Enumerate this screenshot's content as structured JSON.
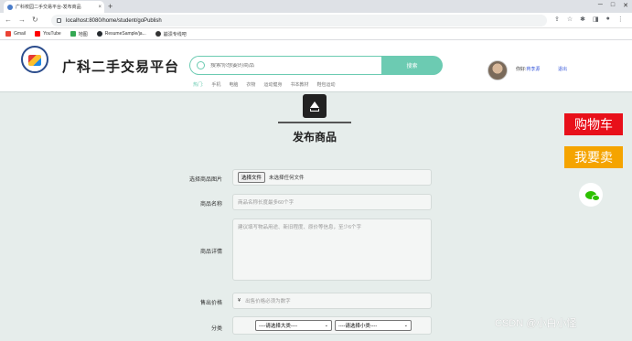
{
  "browser": {
    "tab_title": "广科校园二手交易平台-发布商品",
    "tab_close": "×",
    "new_tab": "+",
    "url": "localhost:8080/home/student/goPublish",
    "nav": [
      "←",
      "→",
      "↻"
    ],
    "window_controls": [
      "─",
      "□",
      "✕"
    ],
    "toolbar_icons": [
      "⇪",
      "☆",
      "✱",
      "◨",
      "●",
      "⋮"
    ],
    "bookmarks": [
      {
        "label": "Gmail",
        "color": "#ea4335"
      },
      {
        "label": "YouTube",
        "color": "#ff0000"
      },
      {
        "label": "地图",
        "color": "#34a853"
      },
      {
        "label": "ResumeSample/ja...",
        "color": "#24292e"
      },
      {
        "label": "崩溃专线吧",
        "color": "#333333"
      }
    ]
  },
  "header": {
    "site_name": "广科二手交易平台",
    "search_placeholder": "搜索你想要的商品",
    "search_button": "搜索",
    "hot_label": "热门:",
    "hot_links": [
      "手机",
      "电脑",
      "衣物",
      "运动健身",
      "书本教材",
      "鞋包运动"
    ],
    "greeting": "你好:",
    "username": "蒋李源",
    "logout": "退出",
    "accent": "#6ccbb2"
  },
  "main": {
    "title": "发布商品",
    "form": {
      "image_label": "选择商品图片",
      "file_button": "选择文件",
      "file_status": "未选择任何文件",
      "name_label": "商品名称",
      "name_placeholder": "商品名称长度最多60个字",
      "desc_label": "商品详情",
      "desc_placeholder": "建议填写物品用途、新旧程度、原价等信息，至少6个字",
      "price_label": "售出价格",
      "price_prefix": "¥",
      "price_placeholder": "出售价格必须为数字",
      "category_label": "分类",
      "category_big": "----请选择大类----",
      "category_small": "----请选择小类----"
    }
  },
  "side": {
    "cart": "购物车",
    "sell": "我要卖"
  },
  "watermark": "CSDN @小白小怪"
}
